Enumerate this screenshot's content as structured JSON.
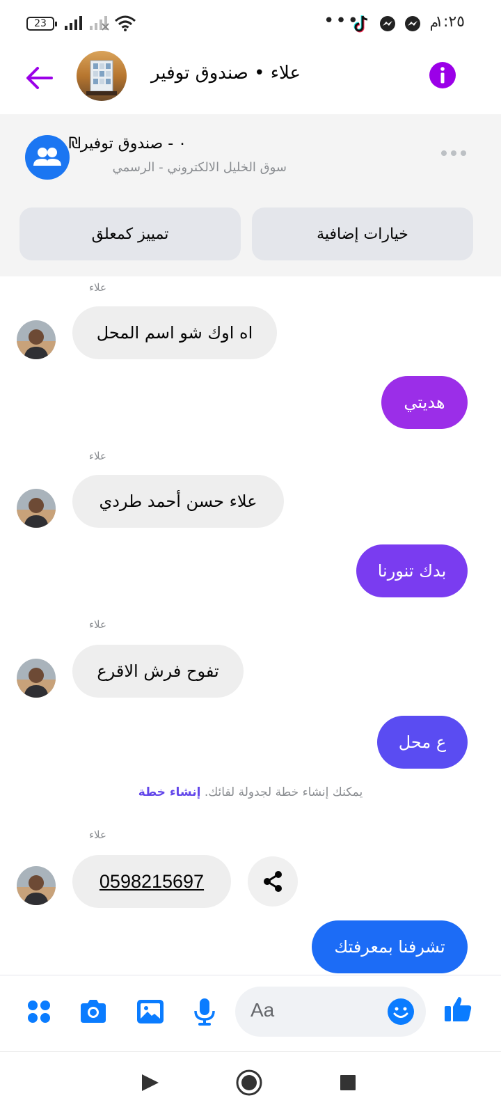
{
  "status_bar": {
    "battery": "23",
    "time": "١:٢٥",
    "am_pm": "م",
    "overflow": "•••"
  },
  "header": {
    "title": "علاء • صندوق توفير",
    "back_icon": "arrow-left-icon",
    "info_icon": "info-icon",
    "accent_color": "#9b00e8"
  },
  "group_card": {
    "name": "₪٠ - صندوق توفير",
    "subtitle": "سوق الخليل الالكتروني - الرسمي",
    "more_icon": "more-horizontal-icon",
    "buttons": {
      "extra_options": "خيارات إضافية",
      "mark_pending": "تمييز كمعلق"
    }
  },
  "messages": [
    {
      "direction": "in",
      "sender": "علاء",
      "text": "اه اوك شو اسم المحل"
    },
    {
      "direction": "out",
      "text": "هديتي",
      "color": "#9b2ee8"
    },
    {
      "direction": "in",
      "sender": "علاء",
      "text": "علاء حسن أحمد طردي"
    },
    {
      "direction": "out",
      "text": "بدك تنورنا",
      "color": "#7a3cf0"
    },
    {
      "direction": "in",
      "sender": "علاء",
      "text": "تفوح فرش الاقرع"
    },
    {
      "direction": "out",
      "text": "ع محل",
      "color": "#5a4cf2"
    },
    {
      "direction": "in",
      "sender": "علاء",
      "text": "0598215697"
    },
    {
      "direction": "out",
      "text": "تشرفنا بمعرفتك",
      "color": "#1c6cf6"
    }
  ],
  "plan_prompt": {
    "text": "يمكنك إنشاء خطة لجدولة لقائك.",
    "link": "إنشاء خطة"
  },
  "composer": {
    "placeholder": "Aa",
    "icons": [
      "apps-icon",
      "camera-icon",
      "gallery-icon",
      "microphone-icon",
      "emoji-icon",
      "thumbs-up-icon"
    ],
    "accent_color": "#0a7cff"
  },
  "nav_bar": {
    "icons": [
      "back-triangle-icon",
      "home-circle-icon",
      "recents-square-icon"
    ]
  }
}
